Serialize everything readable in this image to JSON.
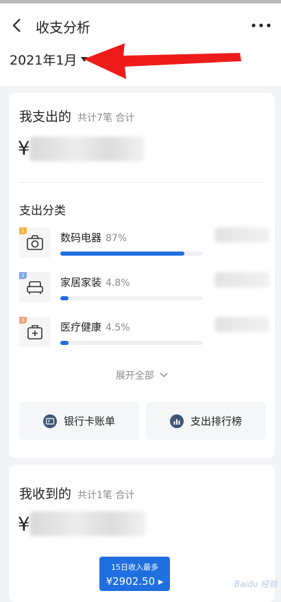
{
  "header": {
    "title": "收支分析",
    "date": "2021年1月"
  },
  "expense": {
    "title": "我支出的",
    "summary": "共计7笔 合计",
    "currency": "¥",
    "section_title": "支出分类",
    "categories": [
      {
        "rank": "1",
        "name": "数码电器",
        "percent": "87%",
        "value": 87,
        "icon": "camera-icon",
        "rank_color": "#f5b23c"
      },
      {
        "rank": "2",
        "name": "家居家装",
        "percent": "4.8%",
        "value": 4.8,
        "icon": "sofa-icon",
        "rank_color": "#7aa7e6"
      },
      {
        "rank": "3",
        "name": "医疗健康",
        "percent": "4.5%",
        "value": 4.5,
        "icon": "medical-kit-icon",
        "rank_color": "#f0a57c"
      }
    ],
    "expand_label": "展开全部",
    "buttons": {
      "bank_bill": "银行卡账单",
      "ranking": "支出排行榜"
    }
  },
  "income": {
    "title": "我收到的",
    "summary": "共计1笔 合计",
    "currency": "¥",
    "tooltip_line1": "15日收入最多",
    "tooltip_line2": "¥2902.50 ▸"
  },
  "watermark": "Baidu 经验"
}
